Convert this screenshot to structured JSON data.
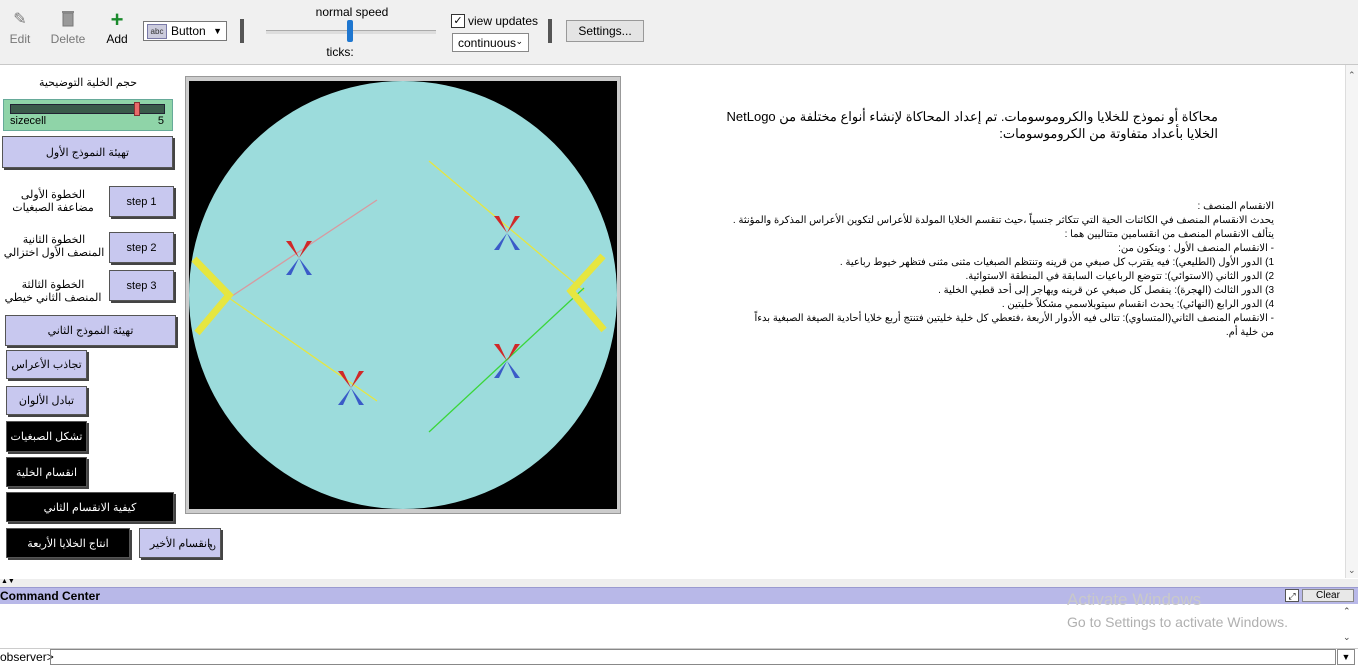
{
  "toolbar": {
    "edit_label": "Edit",
    "delete_label": "Delete",
    "add_label": "Add",
    "widget_type": "Button",
    "widget_type_icon": "abc",
    "speed_label": "normal speed",
    "ticks_label": "ticks:",
    "view_updates_label": "view updates",
    "view_updates_checked": true,
    "update_mode": "continuous",
    "settings_label": "Settings..."
  },
  "interface": {
    "slider_title": "حجم الخلية التوضيحية",
    "slider": {
      "name": "sizecell",
      "value": "5",
      "fraction": 0.83
    },
    "setup1_button": "تهيئة النموذج الأول",
    "step1_label": "الخطوة الأولى\nمضاعفة الصبغيات",
    "step1_button": "step 1",
    "step2_label": "الخطوة الثانية\nالمنصف الأول اختزالي",
    "step2_button": "step 2",
    "step3_label": "الخطوة الثالثة\nالمنصف الثاني خيطي",
    "step3_button": "step 3",
    "setup2_button": "تهيئة النموذج الثاني",
    "homolog_button": "تجاذب الأعراس",
    "color_swap_button": "تبادل الألوان",
    "chromatid_button": "تشكل الصبغيات",
    "cell_division_button": "انقسام الخلية",
    "second_division_button": "كيفية الانقسام الثاني",
    "four_cells_button": "انتاج الخلايا الأربعة",
    "last_division_button": "انقسام الأخير"
  },
  "info": {
    "title_lines": [
      "محاكاة أو نموذج للخلايا والكروموسومات. تم إعداد المحاكاة لإنشاء أنواع مختلفة من  NetLogo",
      "الخلايا بأعداد متفاوتة من الكروموسومات:"
    ],
    "body_lines": [
      "الانقسام المنصف :",
      "يحدث الانقسام المنصف في الكائنات الحية التي تتكاثر جنسياً ،حيث تنقسم الخلايا المولدة للأعراس لتكوين الأعراس المذكرة والمؤنثة .",
      "يتألف الانقسام المنصف من انقسامين متتاليين هما :",
      "- الانقسام المنصف الأول : ويتكون من:",
      "1) الدور الأول (الطليعي): فيه يقترب كل صبغي من قرينه وتنتظم الصبغيات مثنى مثنى فتظهر خيوط رباعية .",
      "2) الدور الثاني (الاستوائي): تتوضع الرباعيات السابقة في المنطقة الاستوائية.",
      "3) الدور الثالث (الهجرة): ينفصل كل صبغي عن قرينه ويهاجر إلى أحد قطبي الخلية .",
      "4) الدور الرابع (النهائي): يحدث انقسام سيتوبلاسمي مشكلاً خليتين .",
      "- الانقسام المنصف الثاني(المتساوي): تتالى فيه الأدوار الأربعة ،فتعطي كل خلية خليتين فتنتج أربع خلايا أحادية الصيغة الصبغية بدءاً",
      "من خلية أم."
    ]
  },
  "command_center": {
    "title": "Command Center",
    "clear_label": "Clear",
    "observer_prompt": "observer>",
    "input_value": ""
  },
  "watermark": {
    "line1": "Activate Windows",
    "line2": "Go to Settings to activate Windows."
  },
  "colors": {
    "button_bg": "#c8c8ef",
    "slider_bg": "#8fd4a8",
    "cell_fill": "#9cdcdc",
    "spindle_yellow": "#e6e640",
    "chromosome_red": "#d02828",
    "chromosome_blue": "#3a5bc8"
  }
}
